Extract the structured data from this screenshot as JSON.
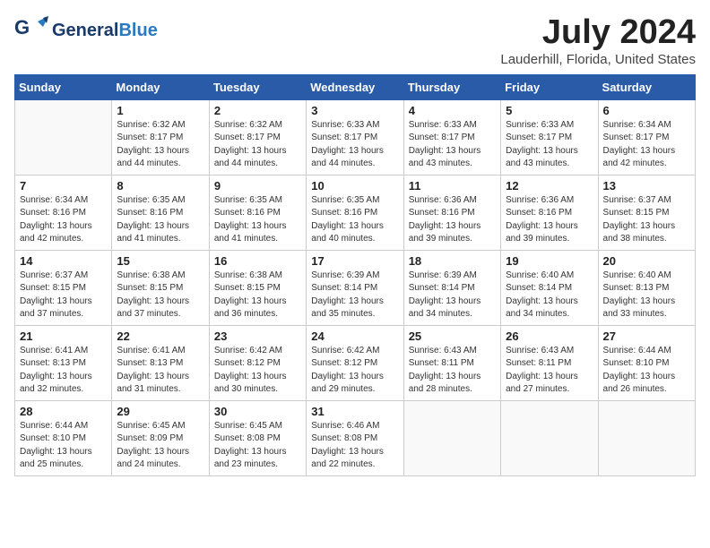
{
  "header": {
    "logo_line1": "General",
    "logo_line2": "Blue",
    "month": "July 2024",
    "location": "Lauderhill, Florida, United States"
  },
  "weekdays": [
    "Sunday",
    "Monday",
    "Tuesday",
    "Wednesday",
    "Thursday",
    "Friday",
    "Saturday"
  ],
  "weeks": [
    [
      {
        "day": "",
        "sunrise": "",
        "sunset": "",
        "daylight": ""
      },
      {
        "day": "1",
        "sunrise": "Sunrise: 6:32 AM",
        "sunset": "Sunset: 8:17 PM",
        "daylight": "Daylight: 13 hours and 44 minutes."
      },
      {
        "day": "2",
        "sunrise": "Sunrise: 6:32 AM",
        "sunset": "Sunset: 8:17 PM",
        "daylight": "Daylight: 13 hours and 44 minutes."
      },
      {
        "day": "3",
        "sunrise": "Sunrise: 6:33 AM",
        "sunset": "Sunset: 8:17 PM",
        "daylight": "Daylight: 13 hours and 44 minutes."
      },
      {
        "day": "4",
        "sunrise": "Sunrise: 6:33 AM",
        "sunset": "Sunset: 8:17 PM",
        "daylight": "Daylight: 13 hours and 43 minutes."
      },
      {
        "day": "5",
        "sunrise": "Sunrise: 6:33 AM",
        "sunset": "Sunset: 8:17 PM",
        "daylight": "Daylight: 13 hours and 43 minutes."
      },
      {
        "day": "6",
        "sunrise": "Sunrise: 6:34 AM",
        "sunset": "Sunset: 8:17 PM",
        "daylight": "Daylight: 13 hours and 42 minutes."
      }
    ],
    [
      {
        "day": "7",
        "sunrise": "Sunrise: 6:34 AM",
        "sunset": "Sunset: 8:16 PM",
        "daylight": "Daylight: 13 hours and 42 minutes."
      },
      {
        "day": "8",
        "sunrise": "Sunrise: 6:35 AM",
        "sunset": "Sunset: 8:16 PM",
        "daylight": "Daylight: 13 hours and 41 minutes."
      },
      {
        "day": "9",
        "sunrise": "Sunrise: 6:35 AM",
        "sunset": "Sunset: 8:16 PM",
        "daylight": "Daylight: 13 hours and 41 minutes."
      },
      {
        "day": "10",
        "sunrise": "Sunrise: 6:35 AM",
        "sunset": "Sunset: 8:16 PM",
        "daylight": "Daylight: 13 hours and 40 minutes."
      },
      {
        "day": "11",
        "sunrise": "Sunrise: 6:36 AM",
        "sunset": "Sunset: 8:16 PM",
        "daylight": "Daylight: 13 hours and 39 minutes."
      },
      {
        "day": "12",
        "sunrise": "Sunrise: 6:36 AM",
        "sunset": "Sunset: 8:16 PM",
        "daylight": "Daylight: 13 hours and 39 minutes."
      },
      {
        "day": "13",
        "sunrise": "Sunrise: 6:37 AM",
        "sunset": "Sunset: 8:15 PM",
        "daylight": "Daylight: 13 hours and 38 minutes."
      }
    ],
    [
      {
        "day": "14",
        "sunrise": "Sunrise: 6:37 AM",
        "sunset": "Sunset: 8:15 PM",
        "daylight": "Daylight: 13 hours and 37 minutes."
      },
      {
        "day": "15",
        "sunrise": "Sunrise: 6:38 AM",
        "sunset": "Sunset: 8:15 PM",
        "daylight": "Daylight: 13 hours and 37 minutes."
      },
      {
        "day": "16",
        "sunrise": "Sunrise: 6:38 AM",
        "sunset": "Sunset: 8:15 PM",
        "daylight": "Daylight: 13 hours and 36 minutes."
      },
      {
        "day": "17",
        "sunrise": "Sunrise: 6:39 AM",
        "sunset": "Sunset: 8:14 PM",
        "daylight": "Daylight: 13 hours and 35 minutes."
      },
      {
        "day": "18",
        "sunrise": "Sunrise: 6:39 AM",
        "sunset": "Sunset: 8:14 PM",
        "daylight": "Daylight: 13 hours and 34 minutes."
      },
      {
        "day": "19",
        "sunrise": "Sunrise: 6:40 AM",
        "sunset": "Sunset: 8:14 PM",
        "daylight": "Daylight: 13 hours and 34 minutes."
      },
      {
        "day": "20",
        "sunrise": "Sunrise: 6:40 AM",
        "sunset": "Sunset: 8:13 PM",
        "daylight": "Daylight: 13 hours and 33 minutes."
      }
    ],
    [
      {
        "day": "21",
        "sunrise": "Sunrise: 6:41 AM",
        "sunset": "Sunset: 8:13 PM",
        "daylight": "Daylight: 13 hours and 32 minutes."
      },
      {
        "day": "22",
        "sunrise": "Sunrise: 6:41 AM",
        "sunset": "Sunset: 8:13 PM",
        "daylight": "Daylight: 13 hours and 31 minutes."
      },
      {
        "day": "23",
        "sunrise": "Sunrise: 6:42 AM",
        "sunset": "Sunset: 8:12 PM",
        "daylight": "Daylight: 13 hours and 30 minutes."
      },
      {
        "day": "24",
        "sunrise": "Sunrise: 6:42 AM",
        "sunset": "Sunset: 8:12 PM",
        "daylight": "Daylight: 13 hours and 29 minutes."
      },
      {
        "day": "25",
        "sunrise": "Sunrise: 6:43 AM",
        "sunset": "Sunset: 8:11 PM",
        "daylight": "Daylight: 13 hours and 28 minutes."
      },
      {
        "day": "26",
        "sunrise": "Sunrise: 6:43 AM",
        "sunset": "Sunset: 8:11 PM",
        "daylight": "Daylight: 13 hours and 27 minutes."
      },
      {
        "day": "27",
        "sunrise": "Sunrise: 6:44 AM",
        "sunset": "Sunset: 8:10 PM",
        "daylight": "Daylight: 13 hours and 26 minutes."
      }
    ],
    [
      {
        "day": "28",
        "sunrise": "Sunrise: 6:44 AM",
        "sunset": "Sunset: 8:10 PM",
        "daylight": "Daylight: 13 hours and 25 minutes."
      },
      {
        "day": "29",
        "sunrise": "Sunrise: 6:45 AM",
        "sunset": "Sunset: 8:09 PM",
        "daylight": "Daylight: 13 hours and 24 minutes."
      },
      {
        "day": "30",
        "sunrise": "Sunrise: 6:45 AM",
        "sunset": "Sunset: 8:08 PM",
        "daylight": "Daylight: 13 hours and 23 minutes."
      },
      {
        "day": "31",
        "sunrise": "Sunrise: 6:46 AM",
        "sunset": "Sunset: 8:08 PM",
        "daylight": "Daylight: 13 hours and 22 minutes."
      },
      {
        "day": "",
        "sunrise": "",
        "sunset": "",
        "daylight": ""
      },
      {
        "day": "",
        "sunrise": "",
        "sunset": "",
        "daylight": ""
      },
      {
        "day": "",
        "sunrise": "",
        "sunset": "",
        "daylight": ""
      }
    ]
  ]
}
